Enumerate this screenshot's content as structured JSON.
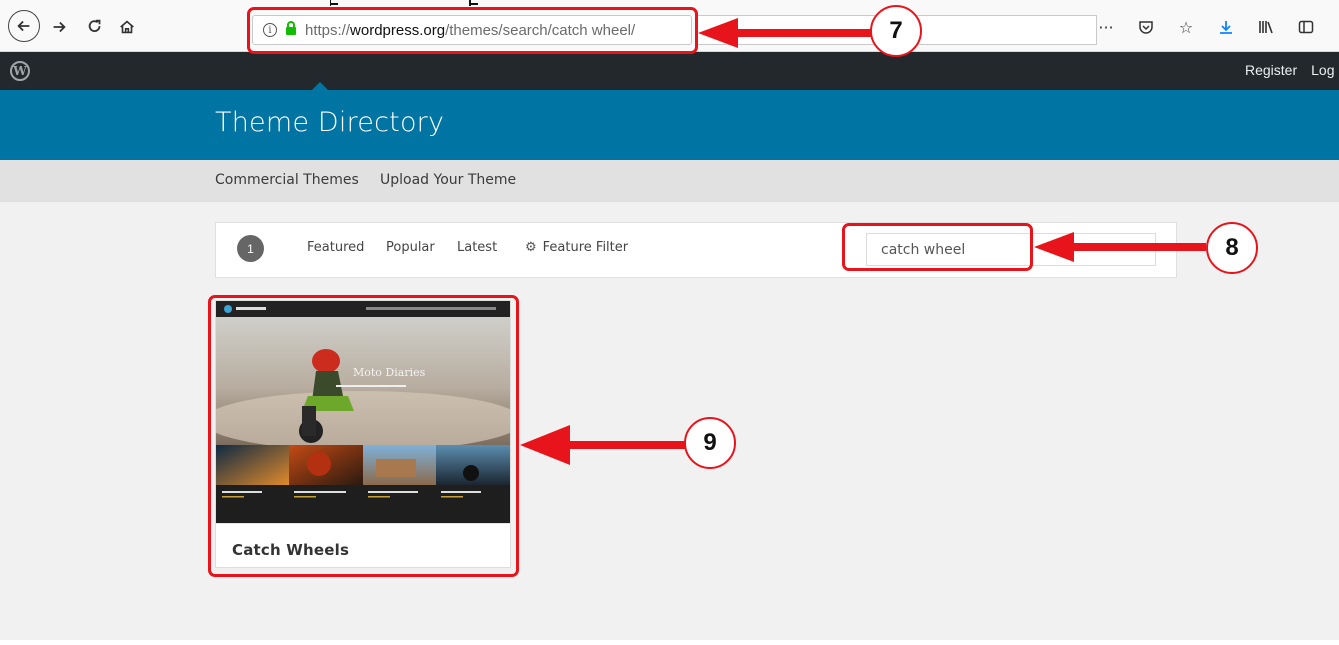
{
  "browser": {
    "url_prefix": "https://",
    "url_domain": "wordpress.org",
    "url_path": "/themes/search/catch wheel/",
    "toolbar_icons": [
      "more-icon",
      "pocket-icon",
      "bookmark-star-icon",
      "download-icon",
      "library-icon",
      "sidebar-icon",
      "extension-icon",
      "firefox-account-icon"
    ]
  },
  "wpbar": {
    "register": "Register",
    "login": "Log"
  },
  "header": {
    "title": "Theme Directory"
  },
  "subnav": {
    "items": [
      "Commercial Themes",
      "Upload Your Theme"
    ]
  },
  "filters": {
    "count": "1",
    "tabs": [
      "Featured",
      "Popular",
      "Latest"
    ],
    "feature_filter": "Feature Filter",
    "search_value": "catch wheel"
  },
  "theme_card": {
    "name": "Catch Wheels"
  },
  "annotations": {
    "step_7": "7",
    "step_8": "8",
    "step_9": "9",
    "color": "#e8141b"
  },
  "colors": {
    "wp_blue": "#0074a2",
    "admin_bar": "#23282d",
    "subnav": "#e1e1e1"
  }
}
